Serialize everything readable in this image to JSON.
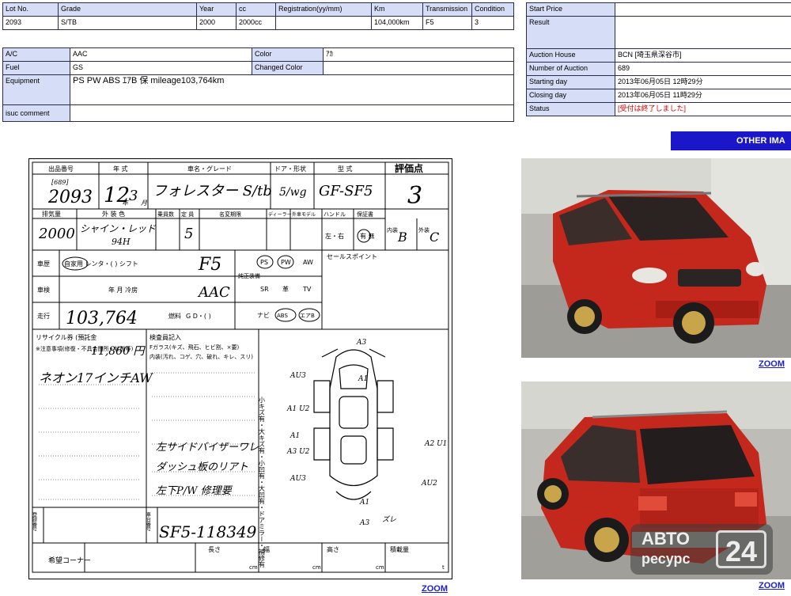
{
  "lot_table": {
    "headers": [
      "Lot No.",
      "Grade",
      "Year",
      "cc",
      "Registration(yy/mm)",
      "Km",
      "Transmission",
      "Condition"
    ],
    "values": [
      "2093",
      "S/TB",
      "2000",
      "2000cc",
      "",
      "104,000km",
      "F5",
      "3"
    ]
  },
  "details": {
    "ac_label": "A/C",
    "ac_value": "AAC",
    "color_label": "Color",
    "color_value": "ｱｶ",
    "fuel_label": "Fuel",
    "fuel_value": "GS",
    "changed_color_label": "Changed Color",
    "changed_color_value": "",
    "equipment_label": "Equipment",
    "equipment_value": "PS PW ABS ｴｱB 保  mileage103,764km",
    "comment_label": "isuc comment",
    "comment_value": ""
  },
  "auction": {
    "start_price_label": "Start Price",
    "start_price_value": "",
    "result_label": "Result",
    "result_value": "",
    "house_label": "Auction House",
    "house_value": "BCN [埼玉県深谷市]",
    "number_label": "Number of Auction",
    "number_value": "689",
    "starting_label": "Starting day",
    "starting_value": "2013年06月05日 12時29分",
    "closing_label": "Closing day",
    "closing_value": "2013年06月05日 11時29分",
    "status_label": "Status",
    "status_value": "[受付は終了しました]"
  },
  "other_images_label": "OTHER IMA",
  "zoom_label": "ZOOM",
  "sheet": {
    "h_lot": "出品番号",
    "h_year": "年 式",
    "h_model": "車名・グレード",
    "h_door": "ドア・形状",
    "h_type": "型 式",
    "h_score": "評価点",
    "lot_small": "[689]",
    "lot": "2093",
    "year": "12",
    "year_unit": "年",
    "month": "3",
    "month_unit": "月",
    "model": "フォレスター S/tb",
    "door": "5/wg",
    "type": "GF-SF5",
    "score": "3",
    "h_cc": "排気量",
    "h_color": "外 装 色",
    "h_cap": "乗員数",
    "h_seats": "定 員",
    "h_inspect": "名変期限",
    "h_dealer": "ディーラー",
    "h_ext": "外車モデル",
    "h_handle": "ハンドル",
    "h_warranty": "保証書",
    "cc": "2000",
    "color": "シャイン・レッド",
    "color_code": "94H",
    "seats": "5",
    "handle_options": "左・右",
    "warranty_options": "有 無",
    "grade_int_label": "内装",
    "grade_int": "B",
    "grade_ext_label": "外装",
    "grade_ext": "C",
    "r_history": "車歴",
    "history_value": "自家用 レンタ・(        ) シフト",
    "shift": "F5",
    "r_inspection": "車検",
    "inspection_value": "年        月 冷房",
    "ac_hand": "AAC",
    "r_mileage": "走行",
    "mileage": "103,764",
    "fuel_label": "燃料",
    "fuel_opts": "G D・(   )",
    "options_label": "純正装備",
    "opt_row1": [
      "PS",
      "PW",
      "AW"
    ],
    "opt_row2": [
      "SR",
      "革",
      "TV"
    ],
    "opt_row3": [
      "ナビ",
      "ABS",
      "エアB"
    ],
    "selling_points_label": "セールスポイント",
    "recycle_label": "リサイクル券 (預託金",
    "recycle_value": "11,860 円",
    "notes_label": "※注意事項(修復・不具合箇所・状態等)",
    "note_line1": "ネオン17インチAW",
    "inspector_label": "検査員記入",
    "glass_label": "Fガラス(キズ、飛石、ヒビ割、×要)",
    "interior_label": "内装(汚れ、コゲ、穴、破れ、キレ、スリ)",
    "insp_note1": "左サイドバイザーワレ",
    "insp_note2": "ダッシュ板のリアト",
    "insp_note3": "左下P/W 修理要",
    "damage_legend": "小キズ有・大キズ有・小凹有・大凹有・ドアミラー・補修有",
    "frame_label": "車台番号",
    "frame_value": "SF5-118349",
    "reg_label": "登録番号",
    "wish_label": "希望コーナー",
    "length_label": "長さ",
    "width_label": "幅",
    "height_label": "高さ",
    "load_label": "積載量",
    "unit_cm": "cm",
    "unit_t": "t",
    "damage_marks": [
      "A3",
      "A1",
      "AU3",
      "A1 U2",
      "A1",
      "A3 U2",
      "AU3",
      "A2 U1",
      "AU2",
      "A1",
      "A3",
      "ズレ"
    ]
  },
  "watermark": {
    "brand_line1": "АВТО",
    "brand_line2": "ресурс",
    "brand_number": "24"
  },
  "colors": {
    "header_bg": "#d6ddf6",
    "border": "#2b2b4e",
    "bar_blue": "#1b16c7",
    "link": "#1d1dd6",
    "status_red": "#d20000",
    "car_red": "#c4281c"
  }
}
